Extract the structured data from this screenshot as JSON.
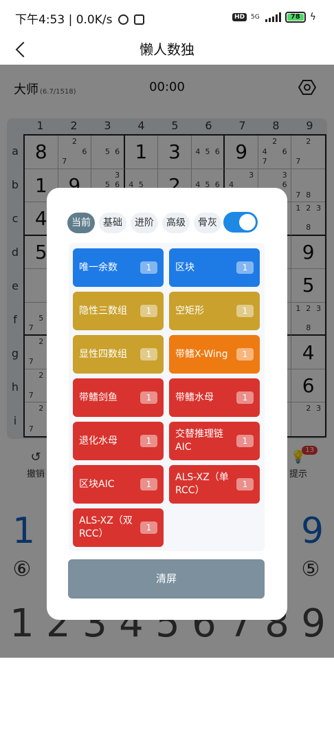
{
  "status": {
    "time_text": "下午4:53 | 0.0K/s",
    "hd": "HD",
    "net": "5G",
    "battery": "78"
  },
  "header": {
    "title": "懒人数独"
  },
  "info": {
    "level": "大师",
    "level_sub": "(6.7/1518)",
    "timer": "00:00"
  },
  "board": {
    "col_labels": [
      "1",
      "2",
      "3",
      "4",
      "5",
      "6",
      "7",
      "8",
      "9"
    ],
    "row_labels": [
      "a",
      "b",
      "c",
      "d",
      "e",
      "f",
      "g",
      "h",
      "i"
    ],
    "cells": [
      [
        "8",
        "2,6,7",
        "5,6",
        "1",
        "3",
        "4,5,6",
        "9",
        "2,4,6,7",
        "2,7"
      ],
      [
        "1",
        "9",
        "3,5,6",
        "4,5",
        "2",
        "4,5,6",
        "4,3",
        "3,6",
        "7,8"
      ],
      [
        "4",
        "",
        "",
        "",
        "",
        "",
        "",
        "",
        "1,2,3,8"
      ],
      [
        "5",
        "",
        "",
        "",
        "",
        "",
        "",
        "",
        "9"
      ],
      [
        "",
        "",
        "",
        "",
        "",
        "",
        "",
        "",
        "5"
      ],
      [
        "5,7",
        "",
        "",
        "",
        "",
        "",
        "",
        "",
        "1,2,3,8"
      ],
      [
        "2,7",
        "",
        "",
        "",
        "",
        "",
        "",
        "",
        "4"
      ],
      [
        "2,7",
        "",
        "",
        "",
        "",
        "",
        "",
        "",
        "6"
      ],
      [
        "2,7",
        "",
        "",
        "",
        "",
        "",
        "",
        "7",
        "2,3"
      ]
    ]
  },
  "tools": {
    "undo": "撤销",
    "hint": "提示",
    "hint_badge": "13"
  },
  "numpad": {
    "left_big": "1",
    "left_circle": "⑥",
    "right_big": "9",
    "right_circle": "⑤",
    "digits": [
      "1",
      "2",
      "3",
      "4",
      "5",
      "6",
      "7",
      "8",
      "9"
    ]
  },
  "modal": {
    "tabs": [
      "当前",
      "基础",
      "进阶",
      "高级",
      "骨灰"
    ],
    "active_tab": "当前",
    "toggle_on": true,
    "techniques": [
      {
        "label": "唯一余数",
        "count": "1",
        "color": "#1e7be6"
      },
      {
        "label": "区块",
        "count": "1",
        "color": "#1e7be6"
      },
      {
        "label": "隐性三数组",
        "count": "1",
        "color": "#c9a12c"
      },
      {
        "label": "空矩形",
        "count": "1",
        "color": "#c9a12c"
      },
      {
        "label": "显性四数组",
        "count": "1",
        "color": "#c9a12c"
      },
      {
        "label": "带鳍X-Wing",
        "count": "1",
        "color": "#ee7a12"
      },
      {
        "label": "带鳍剑鱼",
        "count": "1",
        "color": "#d8332e"
      },
      {
        "label": "带鳍水母",
        "count": "1",
        "color": "#d8332e"
      },
      {
        "label": "退化水母",
        "count": "1",
        "color": "#d8332e"
      },
      {
        "label": "交替推理链AIC",
        "count": "1",
        "color": "#d8332e"
      },
      {
        "label": "区块AIC",
        "count": "1",
        "color": "#d8332e"
      },
      {
        "label": "ALS-XZ（单RCC）",
        "count": "1",
        "color": "#d8332e"
      },
      {
        "label": "ALS-XZ（双RCC）",
        "count": "1",
        "color": "#d8332e"
      }
    ],
    "clear_label": "清屏"
  }
}
